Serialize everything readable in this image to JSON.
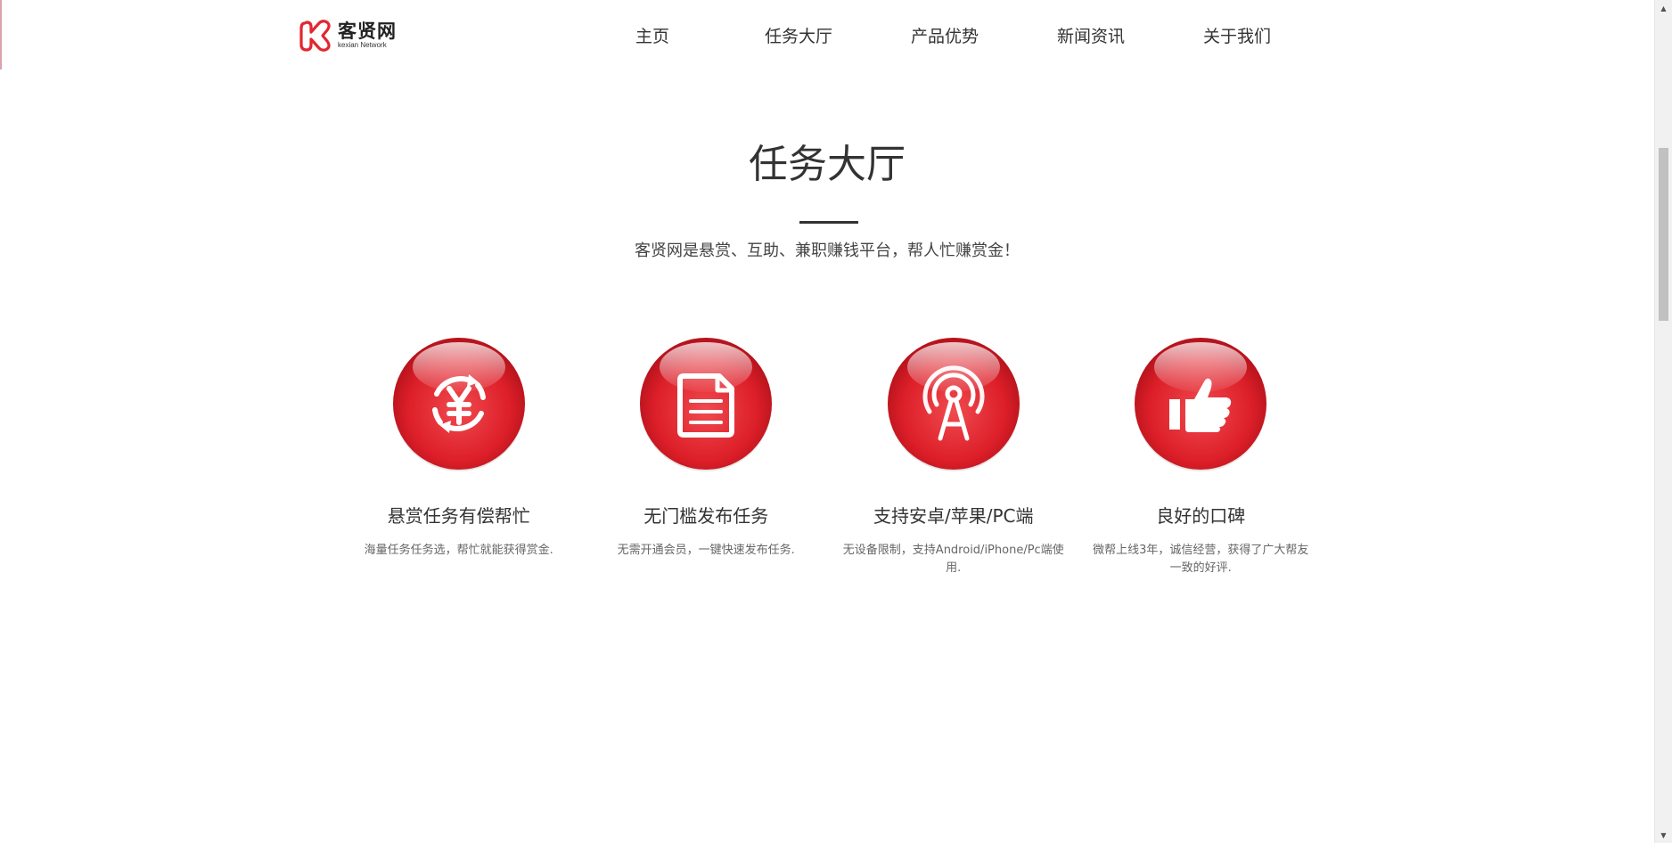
{
  "header": {
    "logo": {
      "name_cn": "客贤网",
      "name_en": "kexian Network"
    },
    "nav": [
      {
        "label": "主页"
      },
      {
        "label": "任务大厅"
      },
      {
        "label": "产品优势"
      },
      {
        "label": "新闻资讯"
      },
      {
        "label": "关于我们"
      }
    ]
  },
  "section": {
    "title": "任务大厅",
    "subtitle": "客贤网是悬赏、互助、兼职赚钱平台，帮人忙赚赏金！"
  },
  "features": [
    {
      "icon": "yuan-exchange-icon",
      "title": "悬赏任务有偿帮忙",
      "desc": "海量任务任务选，帮忙就能获得赏金."
    },
    {
      "icon": "document-icon",
      "title": "无门槛发布任务",
      "desc": "无需开通会员，一键快速发布任务."
    },
    {
      "icon": "signal-tower-icon",
      "title": "支持安卓/苹果/PC端",
      "desc": "无设备限制，支持Android/iPhone/Pc端使用."
    },
    {
      "icon": "thumbs-up-icon",
      "title": "良好的口碑",
      "desc": "微帮上线3年，诚信经营，获得了广大帮友一致的好评."
    }
  ],
  "colors": {
    "accent_red": "#e3262f",
    "text_dark": "#333333",
    "text_muted": "#666666"
  }
}
